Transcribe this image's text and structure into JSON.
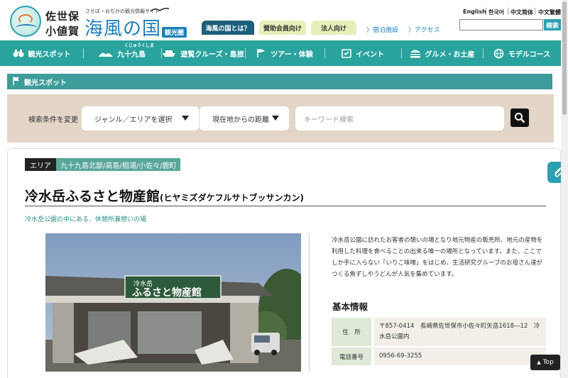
{
  "header": {
    "logo_city_top": "佐世保",
    "logo_city_bottom": "小値賀",
    "logo_tagline": "させぼ・おぢかの観光情報サイト",
    "logo_main": "海風の国",
    "logo_badge": "観光圏",
    "buttons": {
      "about": "海風の国とは？",
      "member": "賛助会員向け",
      "corp": "法人向け"
    },
    "links": {
      "stay": "宿泊施設",
      "access": "アクセス"
    },
    "languages": [
      "English",
      "한국어",
      "中文简体",
      "中文繁體"
    ],
    "search_placeholder": "",
    "search_button": "検索"
  },
  "nav": {
    "items": [
      {
        "label": "観光スポット",
        "icon": "binoculars-icon"
      },
      {
        "label": "九十九島",
        "ruby": "くじゅうくしま",
        "icon": "islands-icon"
      },
      {
        "label": "遊覧クルーズ・島旅",
        "icon": "ship-icon"
      },
      {
        "label": "ツアー・体験",
        "icon": "flag-icon"
      },
      {
        "label": "イベント",
        "icon": "calendar-icon"
      },
      {
        "label": "グルメ・お土産",
        "icon": "burger-icon"
      },
      {
        "label": "モデルコース",
        "icon": "globe-icon"
      }
    ]
  },
  "section": {
    "title": "観光スポット"
  },
  "filter": {
    "label": "検索条件を変更",
    "genre_select": "ジャンル／エリアを選択",
    "distance_select": "現在地からの距離",
    "keyword_placeholder": "キーワード検索"
  },
  "spot": {
    "area_key": "エリア",
    "area_value": "九十九島北部/高島/相浦/小佐々/鹿町",
    "title": "冷水岳ふるさと物産館",
    "title_kana": "(ヒヤミズダケフルサトブッサンカン)",
    "lead": "冷水岳公園の中にある、休憩所兼憩いの場",
    "photo_sign_small": "冷水岳",
    "photo_sign": "ふるさと物産館",
    "description": "冷水岳公園に訪れたお客者の憩いの場となり地元物産の販売所、地元の産物を利用した料理を食べることの出来る唯一の場所となっています。また、ここでしか手に入らない「いりこ味噌」をはじめ、生活研究グループのお母さん達がつくる角ずしやうどんが人気を集めています。",
    "basic_info_title": "基本情報",
    "info": [
      {
        "label": "住　所",
        "value": "〒857-0414　長崎県佐世保市小佐々町矢岳1618―12　冷水岳公園内"
      },
      {
        "label": "電話番号",
        "value": "0956-69-3255"
      }
    ]
  },
  "floating": {
    "top_button": "Top"
  },
  "colors": {
    "nav_bg": "#2aa39e",
    "section_bg": "#3e9c9a",
    "filter_bg": "#e3d5c8",
    "logo_blue": "#1b7fb8"
  }
}
